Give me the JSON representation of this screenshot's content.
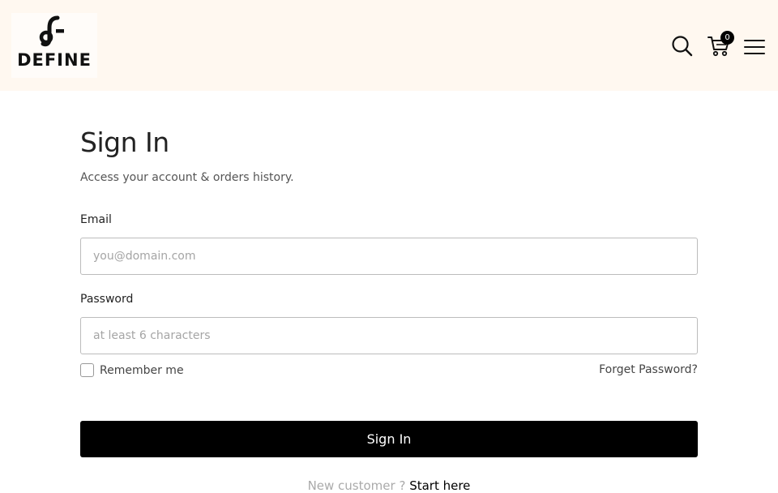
{
  "header": {
    "logo_text": "DEFINE",
    "cart_count": "0",
    "icons": [
      "search-icon",
      "cart-icon",
      "hamburger-menu-icon"
    ]
  },
  "signin": {
    "title": "Sign In",
    "subtitle": "Access your account & orders history.",
    "email": {
      "label": "Email",
      "placeholder": "you@domain.com",
      "value": ""
    },
    "password": {
      "label": "Password",
      "placeholder": "at least 6 characters",
      "value": ""
    },
    "remember_label": "Remember me",
    "forgot_label": "Forget Password?",
    "submit_label": "Sign In",
    "signup_prefix": "New customer ?",
    "signup_link": "Start here"
  },
  "colors": {
    "header_bg": "#fff8f0",
    "primary_button": "#000000",
    "input_border": "#bcbcbc"
  }
}
